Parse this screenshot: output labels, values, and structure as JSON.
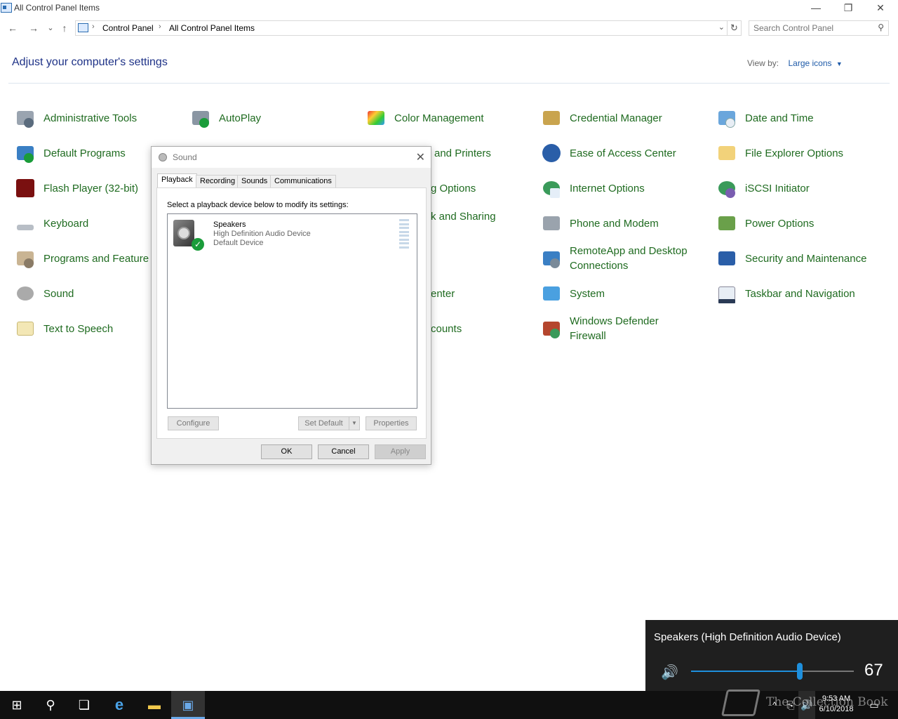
{
  "window": {
    "title": "All Control Panel Items",
    "minimize_glyph": "—",
    "restore_glyph": "❐",
    "close_glyph": "✕"
  },
  "nav": {
    "back_glyph": "←",
    "forward_glyph": "→",
    "recent_glyph": "⌄",
    "up_glyph": "↑",
    "breadcrumb": [
      "Control Panel",
      "All Control Panel Items"
    ],
    "separator": "›",
    "dropdown_glyph": "⌄",
    "refresh_glyph": "↻",
    "search_placeholder": "Search Control Panel"
  },
  "page": {
    "heading": "Adjust your computer's settings",
    "view_by_label": "View by:",
    "view_by_value": "Large icons",
    "view_by_caret": "▼"
  },
  "items": {
    "administrative_tools": "Administrative Tools",
    "autoplay": "AutoPlay",
    "color_management": "Color Management",
    "credential_manager": "Credential Manager",
    "date_and_time": "Date and Time",
    "default_programs": "Default Programs",
    "devices_and_printers": "and Printers",
    "ease_of_access": "Ease of Access Center",
    "file_explorer_options": "File Explorer Options",
    "flash_player": "Flash Player (32-bit)",
    "indexing_options": "g Options",
    "internet_options": "Internet Options",
    "iscsi_initiator": "iSCSI Initiator",
    "keyboard": "Keyboard",
    "network_and_sharing": "k and Sharing",
    "phone_and_modem": "Phone and Modem",
    "power_options": "Power Options",
    "programs_and_features": "Programs and Feature",
    "remoteapp_line1": "RemoteApp and Desktop",
    "remoteapp_line2": "Connections",
    "security_and_maintenance": "Security and Maintenance",
    "sound": "Sound",
    "sync_center": "enter",
    "system": "System",
    "taskbar_and_navigation": "Taskbar and Navigation",
    "text_to_speech": "Text to Speech",
    "user_accounts": "counts",
    "firewall_line1": "Windows Defender",
    "firewall_line2": "Firewall"
  },
  "dialog": {
    "title": "Sound",
    "close_glyph": "✕",
    "tabs": [
      "Playback",
      "Recording",
      "Sounds",
      "Communications"
    ],
    "instruction": "Select a playback device below to modify its settings:",
    "device": {
      "name": "Speakers",
      "description": "High Definition Audio Device",
      "status": "Default Device",
      "check_glyph": "✓"
    },
    "configure": "Configure",
    "set_default": "Set Default",
    "set_default_arrow": "▼",
    "properties": "Properties",
    "ok": "OK",
    "cancel": "Cancel",
    "apply": "Apply"
  },
  "volume_flyout": {
    "device": "Speakers (High Definition Audio Device)",
    "speaker_glyph": "🔊",
    "level": 67,
    "level_text": "67"
  },
  "taskbar": {
    "start_glyph": "⊞",
    "search_glyph": "⚲",
    "taskview_glyph": "❏",
    "ie_glyph": "e",
    "explorer_glyph": "▬",
    "cp_glyph": "▣",
    "tray_chevron": "^",
    "network_glyph": "⎘",
    "volume_glyph": "🔊",
    "notification_glyph": "▭",
    "time": "9:53 AM",
    "date": "6/10/2018"
  },
  "watermark": "The Collection Book"
}
